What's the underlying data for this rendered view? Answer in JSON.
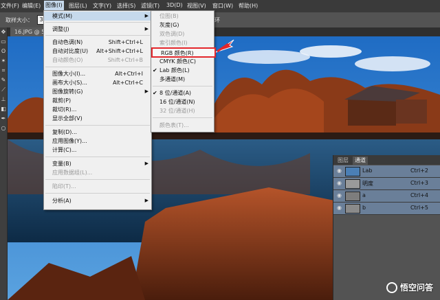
{
  "menubar": {
    "items": [
      "文件(F)",
      "编辑(E)",
      "图像(I)",
      "图层(L)",
      "文字(Y)",
      "选择(S)",
      "滤镜(T)",
      "3D(D)",
      "视图(V)",
      "窗口(W)",
      "帮助(H)"
    ],
    "active_index": 2
  },
  "options_bar": {
    "sample_size_label": "取样大小：",
    "sample_size_value": "3",
    "trailing_text": "环"
  },
  "document": {
    "tab_title": "16.JPG @ 50"
  },
  "image_menu": {
    "items": [
      {
        "label": "模式(M)",
        "shortcut": "",
        "submenu": true,
        "disabled": false,
        "highlighted": true
      },
      {
        "label": "调整(J)",
        "shortcut": "",
        "submenu": true,
        "disabled": false
      },
      {
        "label": "自动色调(N)",
        "shortcut": "Shift+Ctrl+L",
        "disabled": false
      },
      {
        "label": "自动对比度(U)",
        "shortcut": "Alt+Shift+Ctrl+L",
        "disabled": false
      },
      {
        "label": "自动颜色(O)",
        "shortcut": "Shift+Ctrl+B",
        "disabled": true
      },
      {
        "label": "图像大小(I)...",
        "shortcut": "Alt+Ctrl+I",
        "disabled": false
      },
      {
        "label": "画布大小(S)...",
        "shortcut": "Alt+Ctrl+C",
        "disabled": false
      },
      {
        "label": "图像旋转(G)",
        "shortcut": "",
        "submenu": true,
        "disabled": false
      },
      {
        "label": "裁剪(P)",
        "shortcut": "",
        "disabled": false
      },
      {
        "label": "裁切(R)...",
        "shortcut": "",
        "disabled": false
      },
      {
        "label": "显示全部(V)",
        "shortcut": "",
        "disabled": false
      },
      {
        "label": "复制(D)...",
        "shortcut": "",
        "disabled": false
      },
      {
        "label": "应用图像(Y)...",
        "shortcut": "",
        "disabled": false
      },
      {
        "label": "计算(C)...",
        "shortcut": "",
        "disabled": false
      },
      {
        "label": "变量(B)",
        "shortcut": "",
        "submenu": true,
        "disabled": false
      },
      {
        "label": "应用数据组(L)...",
        "shortcut": "",
        "disabled": true
      },
      {
        "label": "陷印(T)...",
        "shortcut": "",
        "disabled": true
      },
      {
        "label": "分析(A)",
        "shortcut": "",
        "submenu": true,
        "disabled": false
      }
    ]
  },
  "mode_submenu": {
    "items": [
      {
        "label": "位图(B)",
        "disabled": true
      },
      {
        "label": "灰度(G)",
        "disabled": false
      },
      {
        "label": "双色调(D)",
        "disabled": true
      },
      {
        "label": "索引颜色(I)",
        "disabled": true
      },
      {
        "label": "RGB 颜色(R)",
        "disabled": false,
        "boxed": true
      },
      {
        "label": "CMYK 颜色(C)",
        "disabled": false
      },
      {
        "label": "Lab 颜色(L)",
        "disabled": false,
        "checked": true
      },
      {
        "label": "多通道(M)",
        "disabled": false
      },
      {
        "label": "8 位/通道(A)",
        "disabled": false,
        "checked": true
      },
      {
        "label": "16 位/通道(N)",
        "disabled": false
      },
      {
        "label": "32 位/通道(H)",
        "disabled": true
      },
      {
        "label": "颜色表(T)...",
        "disabled": true
      }
    ]
  },
  "channels_panel": {
    "tabs": [
      "图层",
      "通道"
    ],
    "active_tab": 1,
    "channels": [
      {
        "name": "Lab",
        "shortcut": "Ctrl+2"
      },
      {
        "name": "明度",
        "shortcut": "Ctrl+3"
      },
      {
        "name": "a",
        "shortcut": "Ctrl+4"
      },
      {
        "name": "b",
        "shortcut": "Ctrl+5"
      }
    ]
  },
  "colors": {
    "menu_highlight": "#c6d9ec",
    "red_annotation": "#e3262b",
    "panel_selected": "#6a7f99"
  },
  "watermark": {
    "text": "悟空问答"
  }
}
